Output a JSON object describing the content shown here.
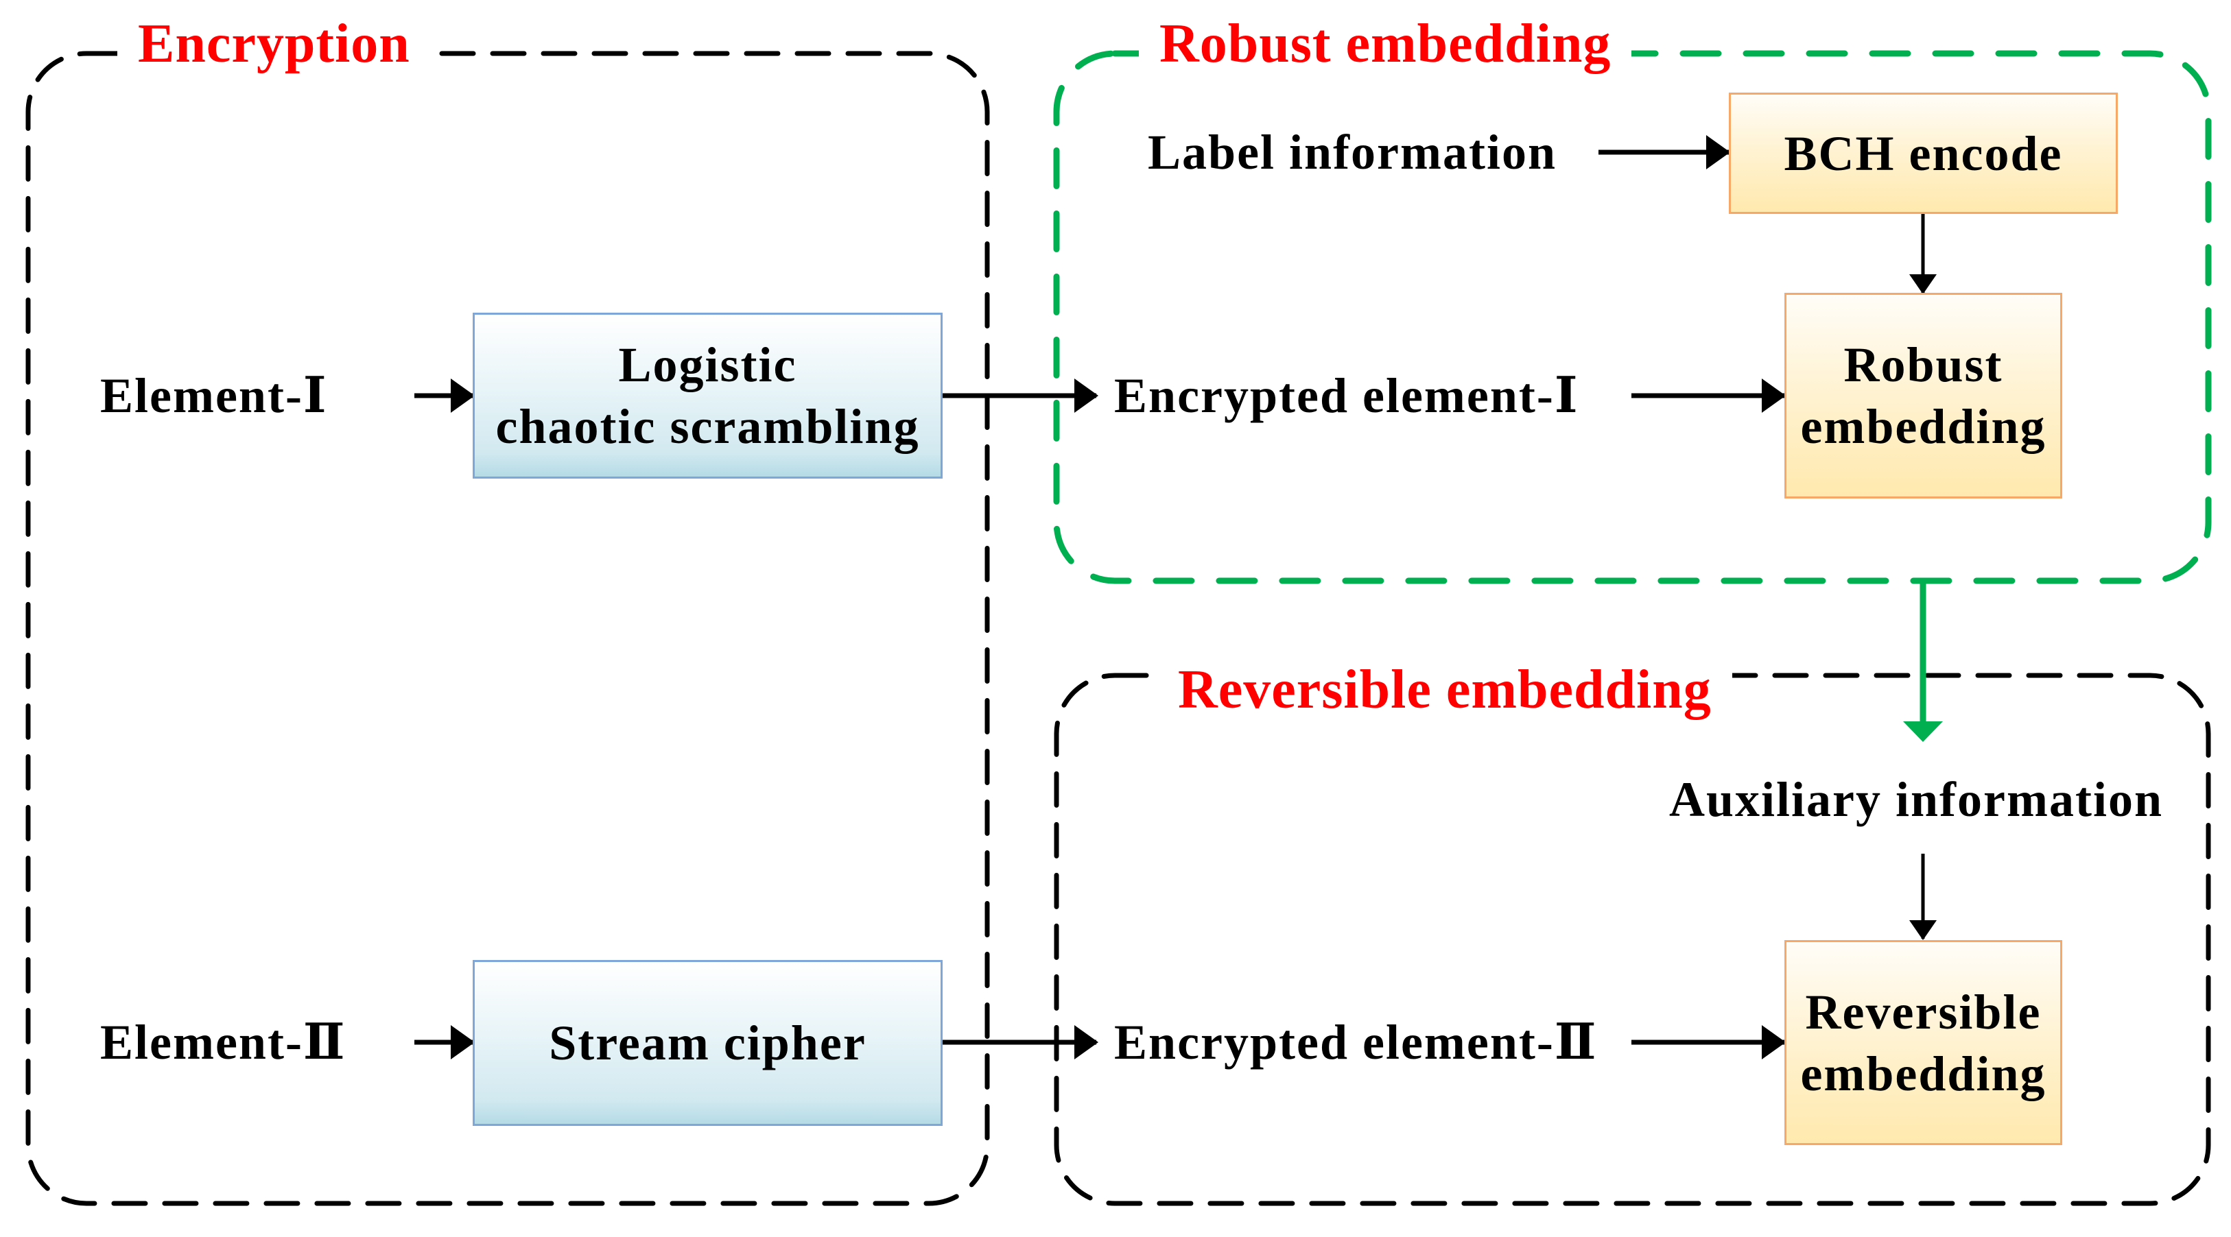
{
  "diagram": {
    "groups": {
      "encryption": {
        "title": "Encryption",
        "border_color": "#000000"
      },
      "robust": {
        "title": "Robust embedding",
        "border_color": "#00b050"
      },
      "reversible": {
        "title": "Reversible embedding",
        "border_color": "#000000"
      }
    },
    "nodes": {
      "element_1": "Element-Ⅰ",
      "element_2": "Element-Ⅱ",
      "logistic_line1": "Logistic",
      "logistic_line2": "chaotic scrambling",
      "stream_cipher": "Stream cipher",
      "encrypted_element_1": "Encrypted element-Ⅰ",
      "encrypted_element_2": "Encrypted element-Ⅱ",
      "label_information": "Label information",
      "bch_encode": "BCH encode",
      "robust_embedding_line1": "Robust",
      "robust_embedding_line2": "embedding",
      "auxiliary_information": "Auxiliary information",
      "reversible_embedding_line1": "Reversible",
      "reversible_embedding_line2": "embedding"
    },
    "edges": [
      {
        "from": "Element-Ⅰ",
        "to": "Logistic chaotic scrambling"
      },
      {
        "from": "Logistic chaotic scrambling",
        "to": "Encrypted element-Ⅰ"
      },
      {
        "from": "Encrypted element-Ⅰ",
        "to": "Robust embedding"
      },
      {
        "from": "Label information",
        "to": "BCH encode"
      },
      {
        "from": "BCH encode",
        "to": "Robust embedding"
      },
      {
        "from": "Robust embedding (group)",
        "to": "Auxiliary information",
        "color": "#00b050"
      },
      {
        "from": "Auxiliary information",
        "to": "Reversible embedding"
      },
      {
        "from": "Element-Ⅱ",
        "to": "Stream cipher"
      },
      {
        "from": "Stream cipher",
        "to": "Encrypted element-Ⅱ"
      },
      {
        "from": "Encrypted element-Ⅱ",
        "to": "Reversible embedding"
      }
    ],
    "colors": {
      "title_red": "#ff0000",
      "green": "#00b050",
      "blue_box_border": "#7fa6d8",
      "orange_box_border": "#f7a766"
    }
  }
}
